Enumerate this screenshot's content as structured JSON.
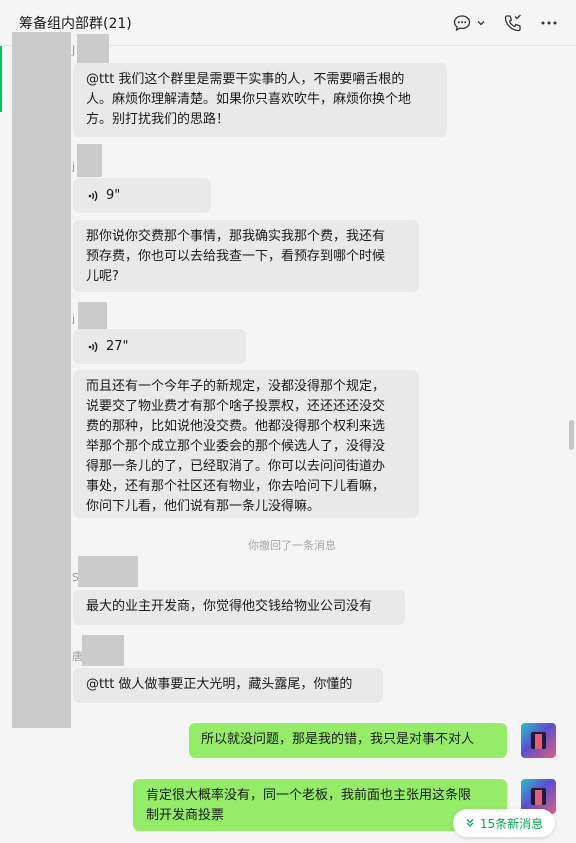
{
  "header": {
    "title": "筹备组内部群(21)",
    "icons": [
      "chat-history-icon",
      "chevron-down-icon",
      "call-icon",
      "more-icon"
    ]
  },
  "sender_fragments": [
    "J",
    "j",
    "j",
    "S",
    "唐"
  ],
  "messages": [
    {
      "type": "text",
      "text_lines": [
        "@ttt 我们这个群里是需要干实事的人，不需要嚼舌根的",
        "人。麻烦你理解清楚。如果你只喜欢吹牛，麻烦你换个地",
        "方。别打扰我们的思路！"
      ]
    },
    {
      "type": "voice",
      "duration": "9\""
    },
    {
      "type": "text",
      "text_lines": [
        "那你说你交费那个事情，那我确实我那个费，我还有",
        "预存费，你也可以去给我查一下，看预存到哪个时候",
        "儿呢?"
      ]
    },
    {
      "type": "voice",
      "duration": "27\""
    },
    {
      "type": "text",
      "text_lines": [
        "而且还有一个今年子的新规定，没都没得那个规定，",
        "说要交了物业费才有那个啥子投票权，还还还还没交",
        "费的那种，比如说他没交费。他都没得那个权利来选",
        "举那个那个成立那个业委会的那个候选人了，没得没",
        "得那一条儿的了，已经取消了。你可以去问问街道办",
        "事处，还有那个社区还有物业，你去哈问下儿看嘛，",
        "你问下儿看，他们说有那一条儿没得嘛。"
      ]
    },
    {
      "type": "system",
      "text": "你撤回了一条消息"
    },
    {
      "type": "text",
      "text_lines": [
        "最大的业主开发商，你觉得他交钱给物业公司没有"
      ]
    },
    {
      "type": "text",
      "text_lines": [
        "@ttt 做人做事要正大光明，藏头露尾，你懂的"
      ]
    },
    {
      "type": "mine",
      "text_lines": [
        "所以就没问题，那是我的错，我只是对事不对人"
      ]
    },
    {
      "type": "mine",
      "text_lines": [
        "肯定很大概率没有，同一个老板，我前面也主张用这条限",
        "制开发商投票"
      ]
    }
  ],
  "new_messages_label": "15条新消息",
  "colors": {
    "my_bubble": "#95ec69",
    "other_bubble": "#e9e9e9",
    "accent": "#07c160"
  }
}
